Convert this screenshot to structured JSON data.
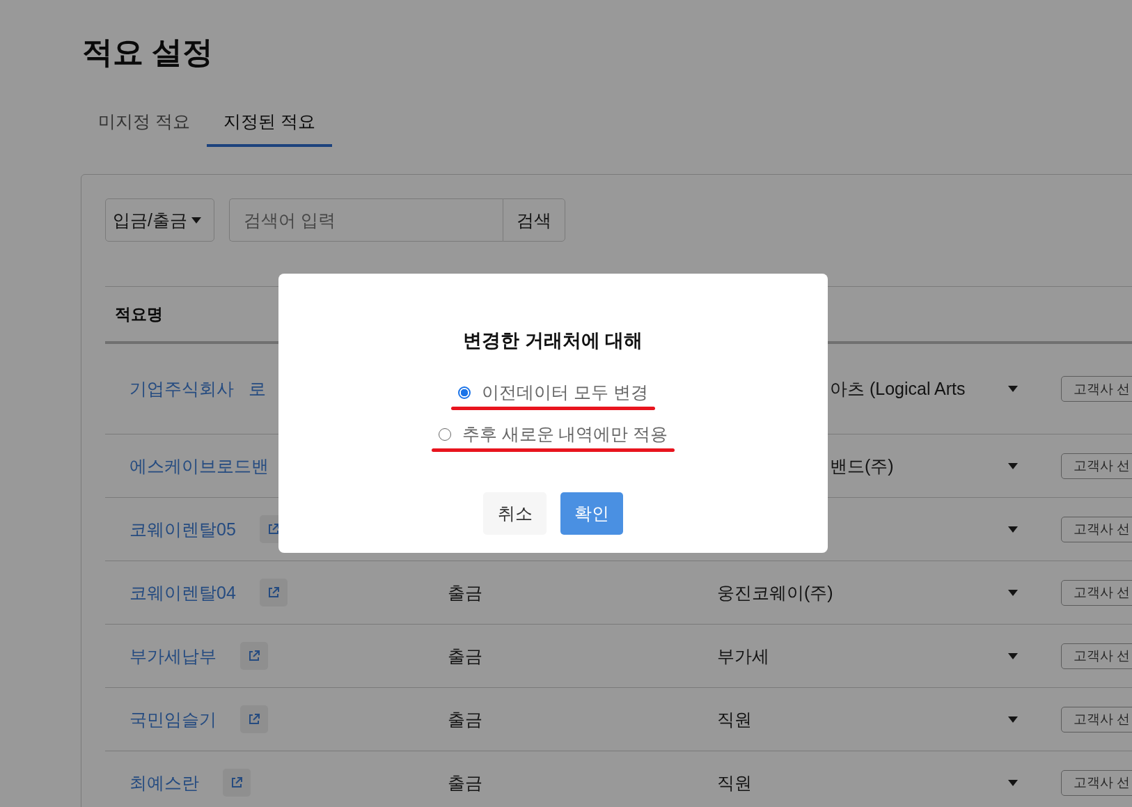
{
  "page": {
    "title": "적요 설정"
  },
  "tabs": [
    {
      "label": "미지정 적요",
      "selected": false
    },
    {
      "label": "지정된 적요",
      "selected": true
    }
  ],
  "filter": {
    "type_select": "입금/출금",
    "search": {
      "placeholder": "검색어 입력"
    },
    "search_button": "검색"
  },
  "table": {
    "columns": [
      {
        "label": "적요명"
      }
    ],
    "rows": [
      {
        "name": "기업주식회사   로",
        "account": "아츠 (Logical Arts",
        "account_cut": true,
        "link_icon": false,
        "button": "고객사 선"
      },
      {
        "name": "에스케이브로드밴",
        "account": "밴드(주)",
        "account_cut": true,
        "link_icon": false,
        "button": "고객사 선"
      },
      {
        "name": "코웨이렌탈05",
        "link_icon": true,
        "button": "고객사 선"
      },
      {
        "name": "코웨이렌탈04",
        "link_icon": true,
        "type": "출금",
        "account": "웅진코웨이(주)",
        "button": "고객사 선"
      },
      {
        "name": "부가세납부",
        "link_icon": true,
        "type": "출금",
        "account": "부가세",
        "button": "고객사 선"
      },
      {
        "name": "국민임슬기",
        "link_icon": true,
        "type": "출금",
        "account": "직원",
        "button": "고객사 선"
      },
      {
        "name": "최예스란",
        "link_icon": true,
        "type": "출금",
        "account": "직원",
        "button": "고객사 선"
      }
    ]
  },
  "dialog": {
    "title": "변경한 거래처에 대해",
    "options": [
      {
        "label": "이전데이터 모두 변경",
        "selected": true
      },
      {
        "label": "추후 새로운 내역에만 적용",
        "selected": false
      }
    ],
    "buttons": [
      {
        "label": "취소",
        "kind": "secondary"
      },
      {
        "label": "확인",
        "kind": "primary"
      }
    ]
  }
}
